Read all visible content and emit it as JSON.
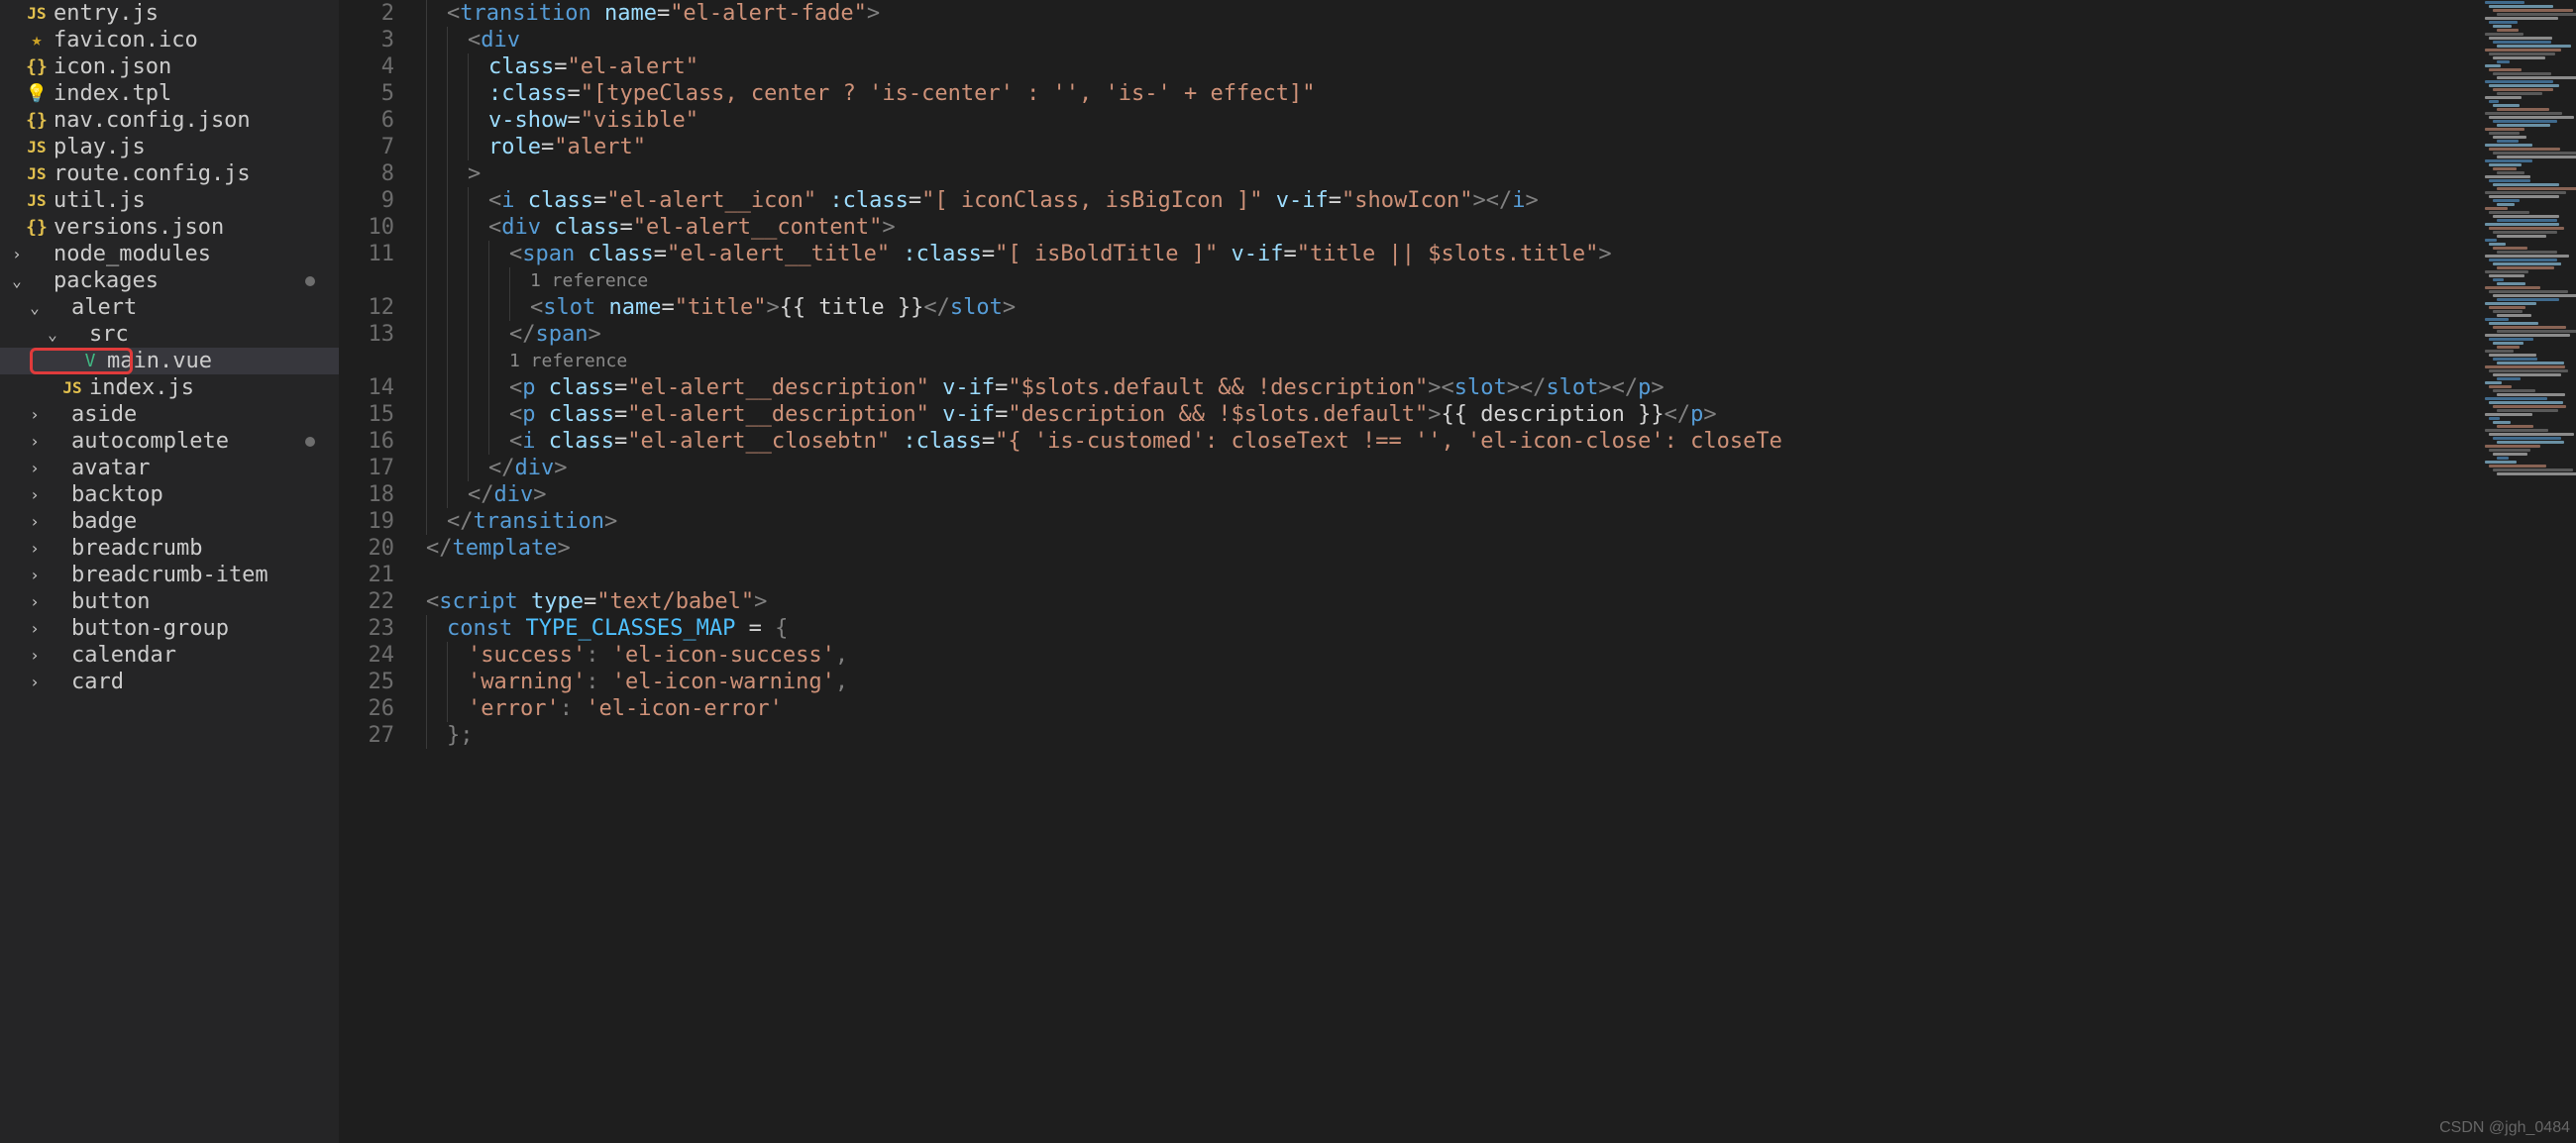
{
  "sidebar": {
    "items": [
      {
        "icon": "js",
        "label": "entry.js",
        "depth": 0,
        "chev": null
      },
      {
        "icon": "star",
        "label": "favicon.ico",
        "depth": 0,
        "chev": null
      },
      {
        "icon": "json",
        "label": "icon.json",
        "depth": 0,
        "chev": null
      },
      {
        "icon": "bulb",
        "label": "index.tpl",
        "depth": 0,
        "chev": null
      },
      {
        "icon": "json",
        "label": "nav.config.json",
        "depth": 0,
        "chev": null
      },
      {
        "icon": "js",
        "label": "play.js",
        "depth": 0,
        "chev": null
      },
      {
        "icon": "js",
        "label": "route.config.js",
        "depth": 0,
        "chev": null
      },
      {
        "icon": "js",
        "label": "util.js",
        "depth": 0,
        "chev": null
      },
      {
        "icon": "json",
        "label": "versions.json",
        "depth": 0,
        "chev": null
      },
      {
        "icon": null,
        "label": "node_modules",
        "depth": 0,
        "chev": "right"
      },
      {
        "icon": null,
        "label": "packages",
        "depth": 0,
        "chev": "down",
        "modified": true
      },
      {
        "icon": null,
        "label": "alert",
        "depth": 1,
        "chev": "down"
      },
      {
        "icon": null,
        "label": "src",
        "depth": 2,
        "chev": "down"
      },
      {
        "icon": "vue",
        "label": "main.vue",
        "depth": 3,
        "chev": null,
        "highlighted": true,
        "boxed": true
      },
      {
        "icon": "js",
        "label": "index.js",
        "depth": 2,
        "chev": null
      },
      {
        "icon": null,
        "label": "aside",
        "depth": 1,
        "chev": "right"
      },
      {
        "icon": null,
        "label": "autocomplete",
        "depth": 1,
        "chev": "right",
        "modified": true
      },
      {
        "icon": null,
        "label": "avatar",
        "depth": 1,
        "chev": "right"
      },
      {
        "icon": null,
        "label": "backtop",
        "depth": 1,
        "chev": "right"
      },
      {
        "icon": null,
        "label": "badge",
        "depth": 1,
        "chev": "right"
      },
      {
        "icon": null,
        "label": "breadcrumb",
        "depth": 1,
        "chev": "right"
      },
      {
        "icon": null,
        "label": "breadcrumb-item",
        "depth": 1,
        "chev": "right"
      },
      {
        "icon": null,
        "label": "button",
        "depth": 1,
        "chev": "right"
      },
      {
        "icon": null,
        "label": "button-group",
        "depth": 1,
        "chev": "right"
      },
      {
        "icon": null,
        "label": "calendar",
        "depth": 1,
        "chev": "right"
      },
      {
        "icon": null,
        "label": "card",
        "depth": 1,
        "chev": "right"
      }
    ]
  },
  "editor": {
    "ref_hint": "1 reference",
    "lines": [
      {
        "n": 2,
        "indent": 1,
        "html": "<span class='p'>&lt;</span><span class='tag'>transition</span> <span class='attr'>name</span><span class='op'>=</span><span class='str'>\"el-alert-fade\"</span><span class='p'>&gt;</span>"
      },
      {
        "n": 3,
        "indent": 2,
        "html": "<span class='p'>&lt;</span><span class='tag'>div</span>"
      },
      {
        "n": 4,
        "indent": 3,
        "html": "<span class='attr'>class</span><span class='op'>=</span><span class='str'>\"el-alert\"</span>"
      },
      {
        "n": 5,
        "indent": 3,
        "html": "<span class='attr'>:class</span><span class='op'>=</span><span class='str'>\"[typeClass, center ? 'is-center' : '', 'is-' + effect]\"</span>"
      },
      {
        "n": 6,
        "indent": 3,
        "html": "<span class='attr'>v-show</span><span class='op'>=</span><span class='str'>\"visible\"</span>"
      },
      {
        "n": 7,
        "indent": 3,
        "html": "<span class='attr'>role</span><span class='op'>=</span><span class='str'>\"alert\"</span>"
      },
      {
        "n": 8,
        "indent": 2,
        "html": "<span class='p'>&gt;</span>"
      },
      {
        "n": 9,
        "indent": 3,
        "html": "<span class='p'>&lt;</span><span class='tag'>i</span> <span class='attr'>class</span><span class='op'>=</span><span class='str'>\"el-alert__icon\"</span> <span class='attr'>:class</span><span class='op'>=</span><span class='str'>\"[ iconClass, isBigIcon ]\"</span> <span class='attr'>v-if</span><span class='op'>=</span><span class='str'>\"showIcon\"</span><span class='p'>&gt;&lt;/</span><span class='tag'>i</span><span class='p'>&gt;</span>"
      },
      {
        "n": 10,
        "indent": 3,
        "html": "<span class='p'>&lt;</span><span class='tag'>div</span> <span class='attr'>class</span><span class='op'>=</span><span class='str'>\"el-alert__content\"</span><span class='p'>&gt;</span>"
      },
      {
        "n": 11,
        "indent": 4,
        "html": "<span class='p'>&lt;</span><span class='tag'>span</span> <span class='attr'>class</span><span class='op'>=</span><span class='str'>\"el-alert__title\"</span> <span class='attr'>:class</span><span class='op'>=</span><span class='str'>\"[ isBoldTitle ]\"</span> <span class='attr'>v-if</span><span class='op'>=</span><span class='str'>\"title || $slots.title\"</span><span class='p'>&gt;</span>"
      },
      {
        "n": null,
        "indent": 5,
        "ref": true
      },
      {
        "n": 12,
        "indent": 5,
        "html": "<span class='p'>&lt;</span><span class='tag'>slot</span> <span class='attr'>name</span><span class='op'>=</span><span class='str'>\"title\"</span><span class='p'>&gt;</span><span class='txt'>{{ title }}</span><span class='p'>&lt;/</span><span class='tag'>slot</span><span class='p'>&gt;</span>"
      },
      {
        "n": 13,
        "indent": 4,
        "html": "<span class='p'>&lt;/</span><span class='tag'>span</span><span class='p'>&gt;</span>"
      },
      {
        "n": null,
        "indent": 4,
        "ref": true
      },
      {
        "n": 14,
        "indent": 4,
        "html": "<span class='p'>&lt;</span><span class='tag'>p</span> <span class='attr'>class</span><span class='op'>=</span><span class='str'>\"el-alert__description\"</span> <span class='attr'>v-if</span><span class='op'>=</span><span class='str'>\"$slots.default &amp;&amp; !description\"</span><span class='p'>&gt;&lt;</span><span class='tag'>slot</span><span class='p'>&gt;&lt;/</span><span class='tag'>slot</span><span class='p'>&gt;&lt;/</span><span class='tag'>p</span><span class='p'>&gt;</span>"
      },
      {
        "n": 15,
        "indent": 4,
        "html": "<span class='p'>&lt;</span><span class='tag'>p</span> <span class='attr'>class</span><span class='op'>=</span><span class='str'>\"el-alert__description\"</span> <span class='attr'>v-if</span><span class='op'>=</span><span class='str'>\"description &amp;&amp; !$slots.default\"</span><span class='p'>&gt;</span><span class='txt'>{{ description }}</span><span class='p'>&lt;/</span><span class='tag'>p</span><span class='p'>&gt;</span>"
      },
      {
        "n": 16,
        "indent": 4,
        "html": "<span class='p'>&lt;</span><span class='tag'>i</span> <span class='attr'>class</span><span class='op'>=</span><span class='str'>\"el-alert__closebtn\"</span> <span class='attr'>:class</span><span class='op'>=</span><span class='str'>\"{ 'is-customed': closeText !== '', 'el-icon-close': closeTe</span>"
      },
      {
        "n": 17,
        "indent": 3,
        "html": "<span class='p'>&lt;/</span><span class='tag'>div</span><span class='p'>&gt;</span>"
      },
      {
        "n": 18,
        "indent": 2,
        "html": "<span class='p'>&lt;/</span><span class='tag'>div</span><span class='p'>&gt;</span>"
      },
      {
        "n": 19,
        "indent": 1,
        "html": "<span class='p'>&lt;/</span><span class='tag'>transition</span><span class='p'>&gt;</span>"
      },
      {
        "n": 20,
        "indent": 0,
        "html": "<span class='p'>&lt;/</span><span class='tag'>template</span><span class='p'>&gt;</span>"
      },
      {
        "n": 21,
        "indent": 0,
        "html": ""
      },
      {
        "n": 22,
        "indent": 0,
        "html": "<span class='p'>&lt;</span><span class='tag'>script</span> <span class='attr'>type</span><span class='op'>=</span><span class='str'>\"text/babel\"</span><span class='p'>&gt;</span>"
      },
      {
        "n": 23,
        "indent": 1,
        "html": "<span class='kw'>const</span> <span class='id'>TYPE_CLASSES_MAP</span> <span class='op'>=</span> <span class='p'>{</span>"
      },
      {
        "n": 24,
        "indent": 2,
        "html": "<span class='str'>'success'</span><span class='p'>:</span> <span class='str'>'el-icon-success'</span><span class='p'>,</span>"
      },
      {
        "n": 25,
        "indent": 2,
        "html": "<span class='str'>'warning'</span><span class='p'>:</span> <span class='str'>'el-icon-warning'</span><span class='p'>,</span>"
      },
      {
        "n": 26,
        "indent": 2,
        "html": "<span class='str'>'error'</span><span class='p'>:</span> <span class='str'>'el-icon-error'</span>"
      },
      {
        "n": 27,
        "indent": 1,
        "html": "<span class='p'>};</span>"
      }
    ]
  },
  "watermark": "CSDN @jgh_0484"
}
